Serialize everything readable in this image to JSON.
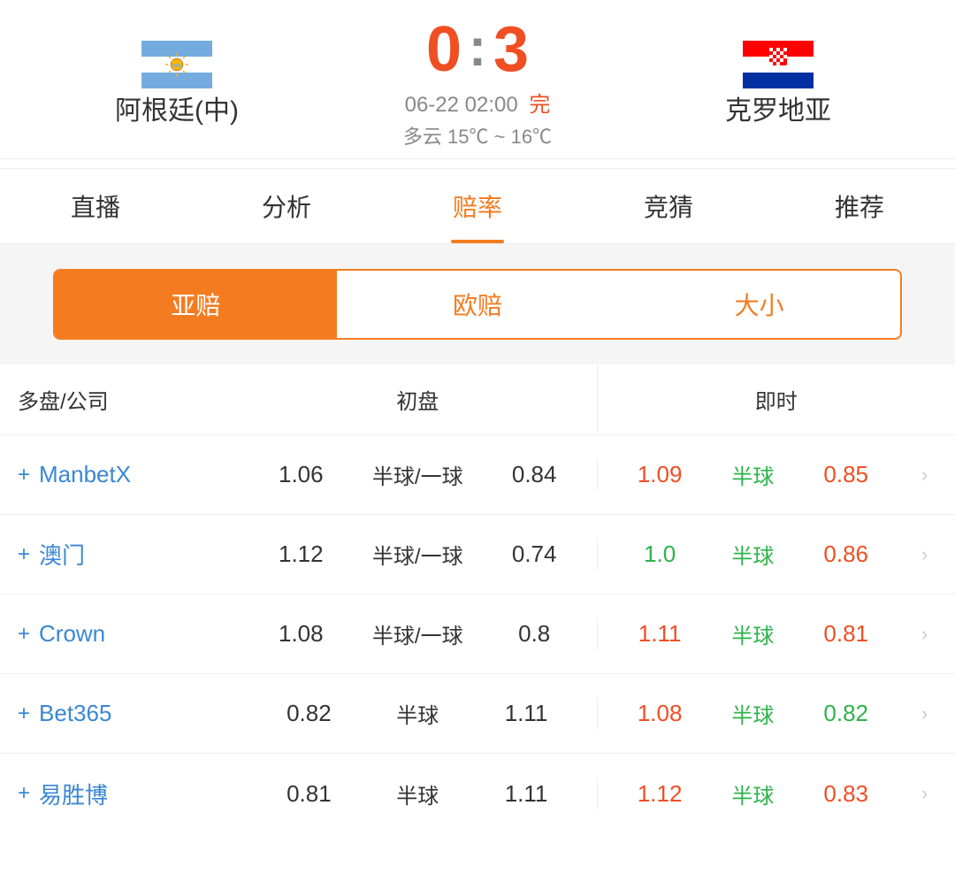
{
  "match": {
    "team_left": "阿根廷(中)",
    "team_right": "克罗地亚",
    "score_left": "0",
    "score_right": "3",
    "colon": ":",
    "date": "06-22 02:00",
    "status": "完",
    "weather": "多云  15℃ ~ 16℃"
  },
  "nav": {
    "tabs": [
      {
        "label": "直播",
        "active": false
      },
      {
        "label": "分析",
        "active": false
      },
      {
        "label": "赔率",
        "active": true
      },
      {
        "label": "竞猜",
        "active": false
      },
      {
        "label": "推荐",
        "active": false
      }
    ]
  },
  "sub_tabs": {
    "tabs": [
      {
        "label": "亚赔",
        "active": true
      },
      {
        "label": "欧赔",
        "active": false
      },
      {
        "label": "大小",
        "active": false
      }
    ]
  },
  "table": {
    "header": {
      "col1": "多盘/公司",
      "col2": "初盘",
      "col3": "即时"
    },
    "rows": [
      {
        "company": "ManbetX",
        "initial_left": "1.06",
        "initial_mid": "半球/一球",
        "initial_right": "0.84",
        "rt_left": "1.09",
        "rt_left_color": "orange",
        "rt_mid": "半球",
        "rt_mid_color": "green",
        "rt_right": "0.85",
        "rt_right_color": "orange"
      },
      {
        "company": "澳门",
        "initial_left": "1.12",
        "initial_mid": "半球/一球",
        "initial_right": "0.74",
        "rt_left": "1.0",
        "rt_left_color": "green",
        "rt_mid": "半球",
        "rt_mid_color": "green",
        "rt_right": "0.86",
        "rt_right_color": "orange"
      },
      {
        "company": "Crown",
        "initial_left": "1.08",
        "initial_mid": "半球/一球",
        "initial_right": "0.8",
        "rt_left": "1.11",
        "rt_left_color": "orange",
        "rt_mid": "半球",
        "rt_mid_color": "green",
        "rt_right": "0.81",
        "rt_right_color": "orange"
      },
      {
        "company": "Bet365",
        "initial_left": "0.82",
        "initial_mid": "半球",
        "initial_right": "1.11",
        "rt_left": "1.08",
        "rt_left_color": "orange",
        "rt_mid": "半球",
        "rt_mid_color": "green",
        "rt_right": "0.82",
        "rt_right_color": "green"
      },
      {
        "company": "易胜博",
        "initial_left": "0.81",
        "initial_mid": "半球",
        "initial_right": "1.11",
        "rt_left": "1.12",
        "rt_left_color": "orange",
        "rt_mid": "半球",
        "rt_mid_color": "green",
        "rt_right": "0.83",
        "rt_right_color": "orange"
      }
    ]
  },
  "icons": {
    "plus": "+",
    "chevron": "›"
  }
}
